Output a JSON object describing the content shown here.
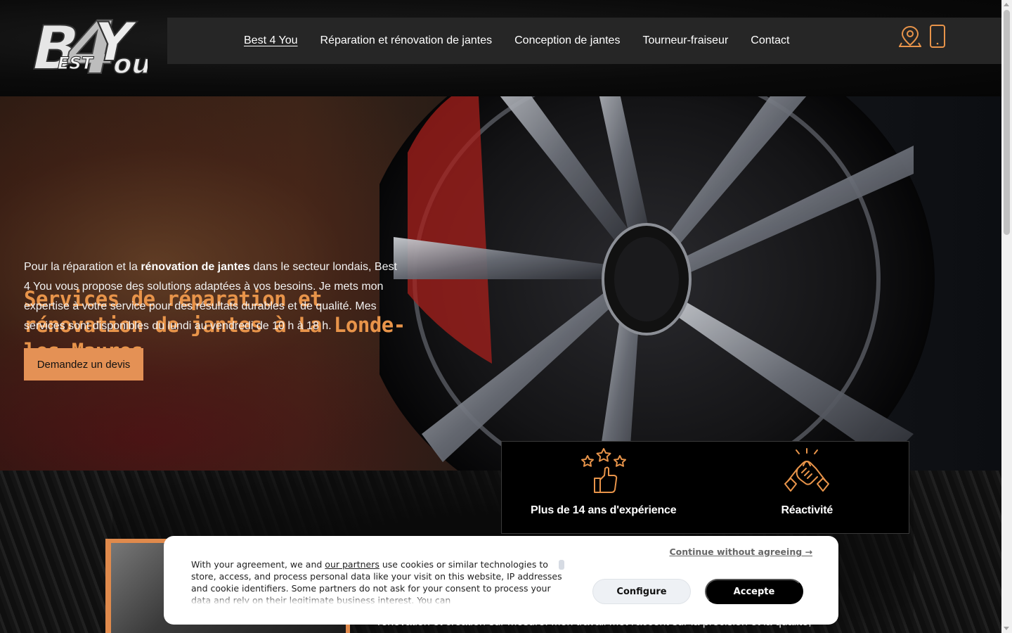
{
  "brand": {
    "logo_text_main": "B4You",
    "logo_text_sub": "EST"
  },
  "nav": {
    "items": [
      {
        "label": "Best 4 You",
        "active": true
      },
      {
        "label": "Réparation et rénovation de jantes",
        "active": false
      },
      {
        "label": "Conception de jantes",
        "active": false
      },
      {
        "label": "Tourneur-fraiseur",
        "active": false
      },
      {
        "label": "Contact",
        "active": false
      }
    ],
    "icons": [
      "location-pin-icon",
      "mobile-phone-icon"
    ]
  },
  "hero": {
    "title": "Services de réparation et rénovation de jantes à La Londe-les-Maures",
    "text_before": "Pour la réparation et la ",
    "text_bold": "rénovation de jantes",
    "text_after": " dans le secteur londais, Best 4 You vous propose des solutions adaptées à vos besoins. Je mets mon expertise à votre service pour des résultats durables et de qualité. Mes services sont disponibles du lundi au vendredi de 10 h à 18 h.",
    "cta_label": "Demandez un devis"
  },
  "features": [
    {
      "icon": "stars-thumbs-up-icon",
      "label": "Plus de 14 ans d'expérience"
    },
    {
      "icon": "handshake-icon",
      "label": "Réactivité"
    }
  ],
  "lower": {
    "text_fragment": "rénovation et création sur mesure. Mon travail met l'accent sur la précision et la qualité,"
  },
  "cookie": {
    "text_before": "With your agreement, we and ",
    "partners_link": "our partners",
    "text_after": " use cookies or similar technologies to store, access, and process personal data like your visit on this website, IP addresses and cookie identifiers. Some partners do not ask for your consent to process your data and rely on their legitimate business interest. You can",
    "continue_label": "Continue without agreeing →",
    "configure_label": "Configure",
    "accept_label": "Accepte"
  },
  "colors": {
    "accent": "#e8944a",
    "cta": "#e49155",
    "nav_bg": "#262626"
  }
}
